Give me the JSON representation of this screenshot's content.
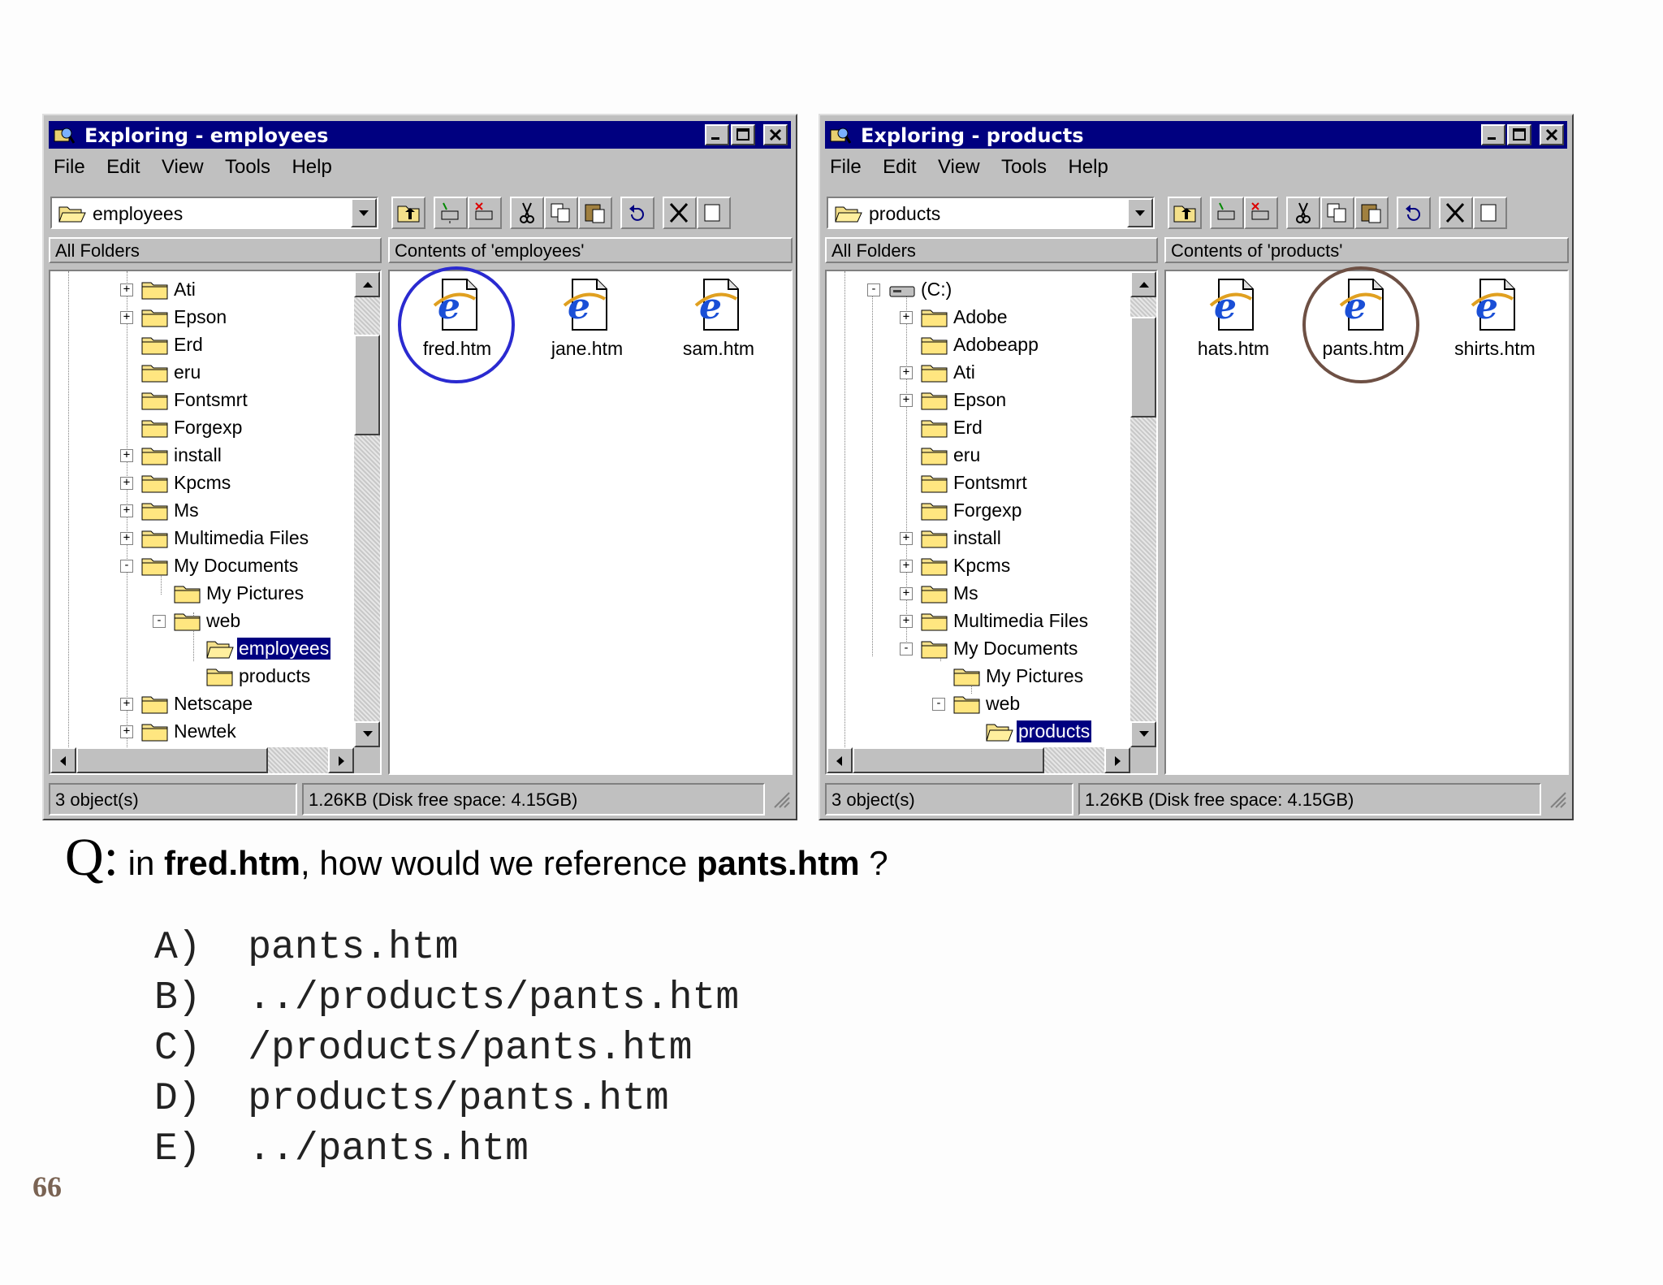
{
  "windows": [
    {
      "title": "Exploring - employees",
      "menu": [
        "File",
        "Edit",
        "View",
        "Tools",
        "Help"
      ],
      "address": "employees",
      "left_header": "All Folders",
      "right_header": "Contents of 'employees'",
      "tree": [
        {
          "label": "Ati",
          "expander": "+",
          "indent": 0
        },
        {
          "label": "Epson",
          "expander": "+",
          "indent": 0
        },
        {
          "label": "Erd",
          "expander": "",
          "indent": 0
        },
        {
          "label": "eru",
          "expander": "",
          "indent": 0
        },
        {
          "label": "Fontsmrt",
          "expander": "",
          "indent": 0
        },
        {
          "label": "Forgexp",
          "expander": "",
          "indent": 0
        },
        {
          "label": "install",
          "expander": "+",
          "indent": 0
        },
        {
          "label": "Kpcms",
          "expander": "+",
          "indent": 0
        },
        {
          "label": "Ms",
          "expander": "+",
          "indent": 0
        },
        {
          "label": "Multimedia Files",
          "expander": "+",
          "indent": 0
        },
        {
          "label": "My Documents",
          "expander": "-",
          "indent": 0
        },
        {
          "label": "My Pictures",
          "expander": "",
          "indent": 1
        },
        {
          "label": "web",
          "expander": "-",
          "indent": 1
        },
        {
          "label": "employees",
          "expander": "",
          "indent": 2,
          "selected": true,
          "open": true
        },
        {
          "label": "products",
          "expander": "",
          "indent": 2
        },
        {
          "label": "Netscape",
          "expander": "+",
          "indent": 0
        },
        {
          "label": "Newtek",
          "expander": "+",
          "indent": 0
        }
      ],
      "files": [
        "fred.htm",
        "jane.htm",
        "sam.htm"
      ],
      "status_count": "3 object(s)",
      "status_size": "1.26KB (Disk free space: 4.15GB)"
    },
    {
      "title": "Exploring - products",
      "menu": [
        "File",
        "Edit",
        "View",
        "Tools",
        "Help"
      ],
      "address": "products",
      "left_header": "All Folders",
      "right_header": "Contents of 'products'",
      "tree": [
        {
          "label": "(C:)",
          "expander": "-",
          "indent": -1,
          "drive": true
        },
        {
          "label": "Adobe",
          "expander": "+",
          "indent": 0
        },
        {
          "label": "Adobeapp",
          "expander": "",
          "indent": 0
        },
        {
          "label": "Ati",
          "expander": "+",
          "indent": 0
        },
        {
          "label": "Epson",
          "expander": "+",
          "indent": 0
        },
        {
          "label": "Erd",
          "expander": "",
          "indent": 0
        },
        {
          "label": "eru",
          "expander": "",
          "indent": 0
        },
        {
          "label": "Fontsmrt",
          "expander": "",
          "indent": 0
        },
        {
          "label": "Forgexp",
          "expander": "",
          "indent": 0
        },
        {
          "label": "install",
          "expander": "+",
          "indent": 0
        },
        {
          "label": "Kpcms",
          "expander": "+",
          "indent": 0
        },
        {
          "label": "Ms",
          "expander": "+",
          "indent": 0
        },
        {
          "label": "Multimedia Files",
          "expander": "+",
          "indent": 0
        },
        {
          "label": "My Documents",
          "expander": "-",
          "indent": 0
        },
        {
          "label": "My Pictures",
          "expander": "",
          "indent": 1
        },
        {
          "label": "web",
          "expander": "-",
          "indent": 1
        },
        {
          "label": "products",
          "expander": "",
          "indent": 2,
          "selected": true,
          "open": true
        }
      ],
      "files": [
        "hats.htm",
        "pants.htm",
        "shirts.htm"
      ],
      "status_count": "3 object(s)",
      "status_size": "1.26KB (Disk free space: 4.15GB)"
    }
  ],
  "question": {
    "prefix": "Q:",
    "part1": " in ",
    "bold1": "fred.htm",
    "part2": ", how would we reference ",
    "bold2": "pants.htm",
    "part3": " ?"
  },
  "answers": [
    "A)  pants.htm",
    "B)  ../products/pants.htm",
    "C)  /products/pants.htm",
    "D)  products/pants.htm",
    "E)  ../pants.htm"
  ],
  "page_number": "66",
  "colors": {
    "titlebar": "#000080",
    "circle_fred": "#2a2ad0",
    "circle_pants": "#6e5044",
    "page_number": "#7a6353"
  }
}
